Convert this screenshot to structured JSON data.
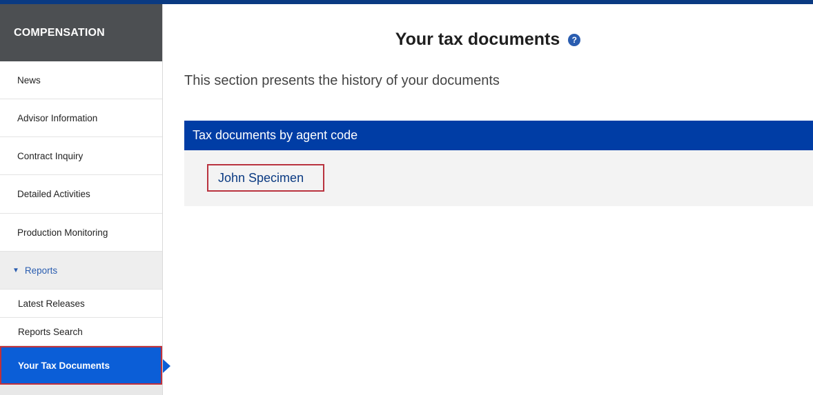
{
  "sidebar": {
    "header": "COMPENSATION",
    "items": [
      {
        "label": "News"
      },
      {
        "label": "Advisor Information"
      },
      {
        "label": "Contract Inquiry"
      },
      {
        "label": "Detailed Activities"
      },
      {
        "label": "Production Monitoring"
      }
    ],
    "reports": {
      "label": "Reports",
      "caret_icon": "triangle-down",
      "subitems": [
        {
          "label": "Latest Releases"
        },
        {
          "label": "Reports Search"
        },
        {
          "label": "Your Tax Documents"
        }
      ]
    }
  },
  "main": {
    "title": "Your tax documents",
    "help_icon": "question-circle",
    "subtitle": "This section presents the history of your documents",
    "panel": {
      "header": "Tax documents by agent code",
      "link": "John Specimen"
    }
  },
  "colors": {
    "topbar": "#0a3a82",
    "sidebar_header": "#4c4f52",
    "active_item": "#0b5ed7",
    "panel_header": "#003da5",
    "highlight_border": "#c0303a"
  }
}
